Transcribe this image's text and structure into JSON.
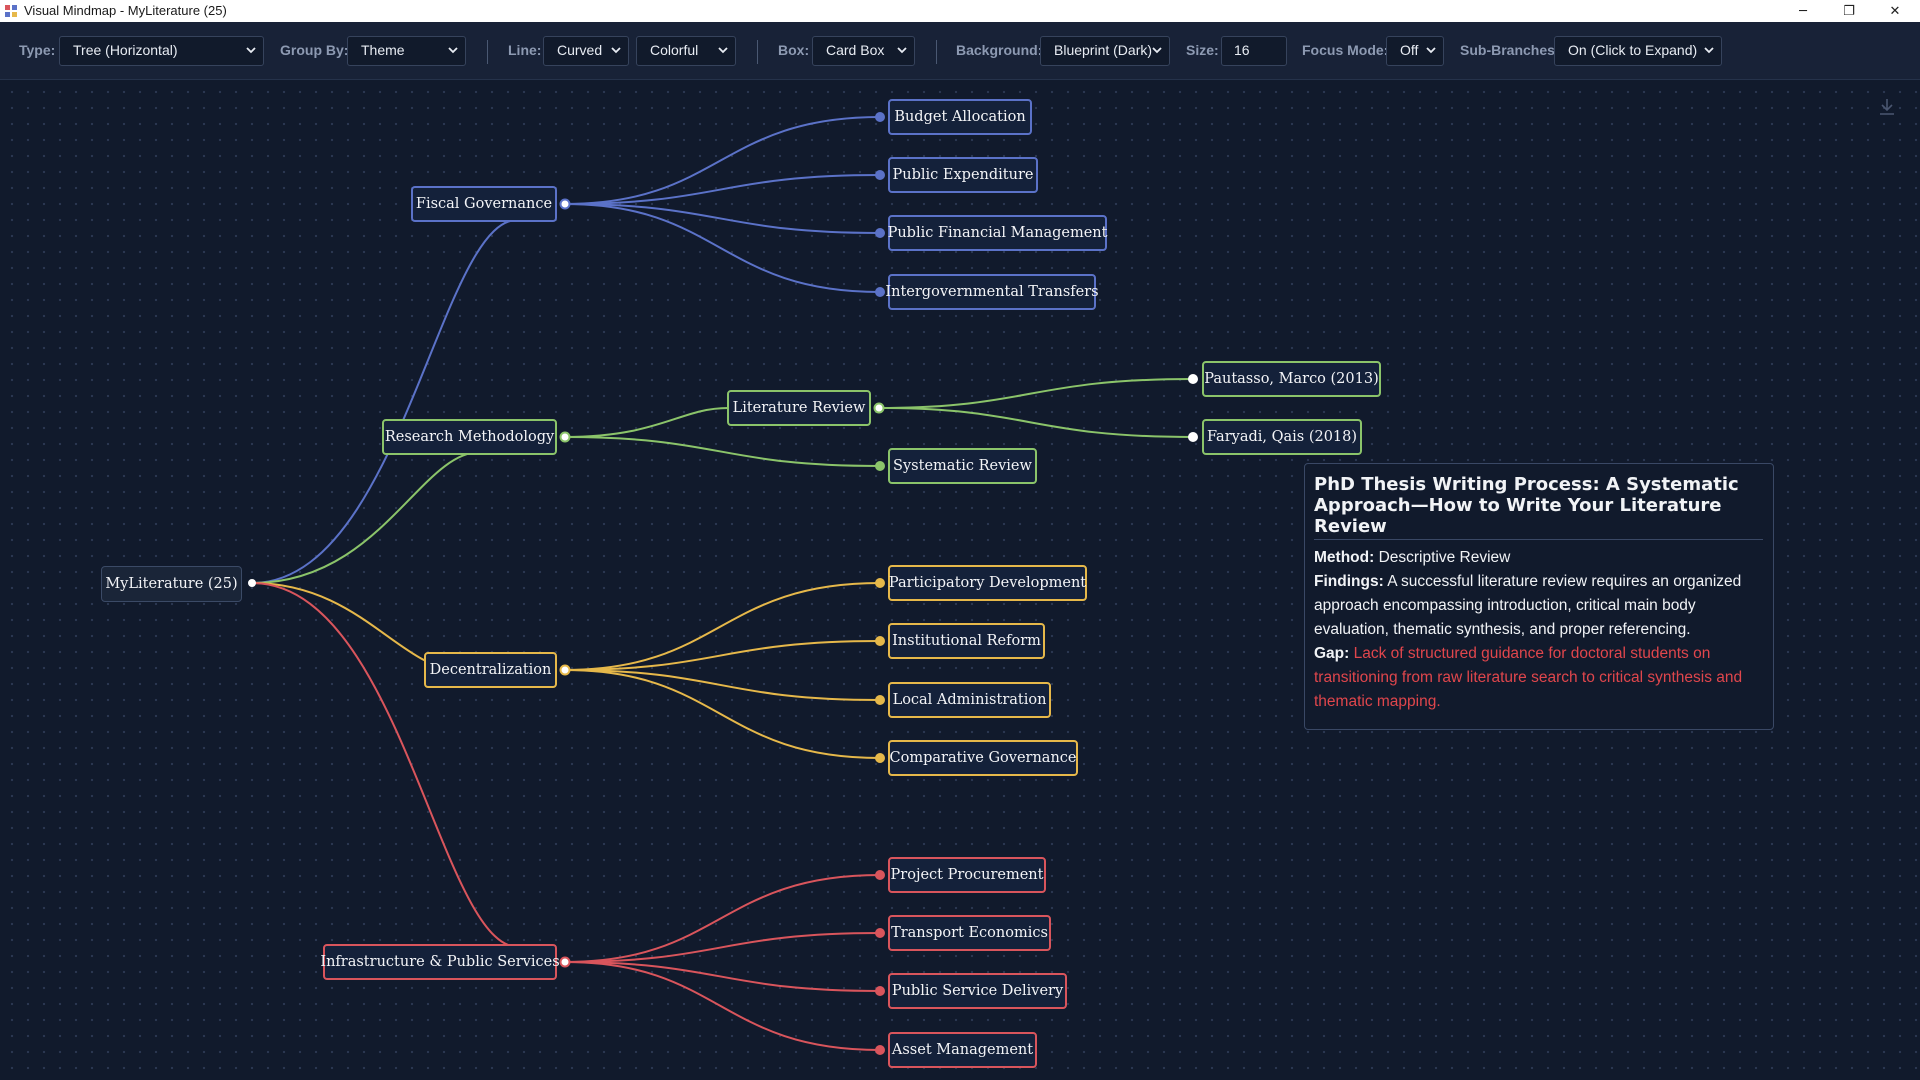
{
  "window": {
    "title": "Visual Mindmap - MyLiterature (25)",
    "minimize": "─",
    "restore": "❐",
    "close": "✕"
  },
  "toolbar": {
    "type_label": "Type:",
    "type_value": "Tree (Horizontal)",
    "groupby_label": "Group By:",
    "groupby_value": "Theme",
    "line_label": "Line:",
    "line_value": "Curved",
    "color_value": "Colorful",
    "box_label": "Box:",
    "box_value": "Card Box",
    "background_label": "Background:",
    "background_value": "Blueprint (Dark)",
    "size_label": "Size:",
    "size_value": "16",
    "focus_label": "Focus Mode:",
    "focus_value": "Off",
    "subbranches_label": "Sub-Branches:",
    "subbranches_value": "On (Click to Expand)"
  },
  "colors": {
    "blue": "#5b72c8",
    "green": "#8bc46a",
    "yellow": "#e6b84a",
    "red": "#d9555c"
  },
  "mindmap": {
    "root": "MyLiterature (25)",
    "themes": {
      "fiscal": {
        "label": "Fiscal Governance",
        "children": [
          "Budget Allocation",
          "Public Expenditure",
          "Public Financial Management",
          "Intergovernmental Transfers"
        ]
      },
      "research": {
        "label": "Research Methodology",
        "literature_review": "Literature Review",
        "systematic_review": "Systematic Review",
        "papers": [
          "Pautasso, Marco (2013)",
          "Faryadi, Qais (2018)"
        ]
      },
      "decentralization": {
        "label": "Decentralization",
        "children": [
          "Participatory Development",
          "Institutional Reform",
          "Local Administration",
          "Comparative Governance"
        ]
      },
      "infrastructure": {
        "label": "Infrastructure & Public Services",
        "children": [
          "Project Procurement",
          "Transport Economics",
          "Public Service Delivery",
          "Asset Management"
        ]
      }
    }
  },
  "tooltip": {
    "title": "PhD Thesis Writing Process: A Systematic Approach—How to Write Your Literature Review",
    "method_label": "Method:",
    "method_value": "Descriptive Review",
    "findings_label": "Findings:",
    "findings_value": "A successful literature review requires an organized approach encompassing introduction, critical main body evaluation, thematic synthesis, and proper referencing.",
    "gap_label": "Gap:",
    "gap_value": "Lack of structured guidance for doctoral students on transitioning from raw literature search to critical synthesis and thematic mapping."
  }
}
